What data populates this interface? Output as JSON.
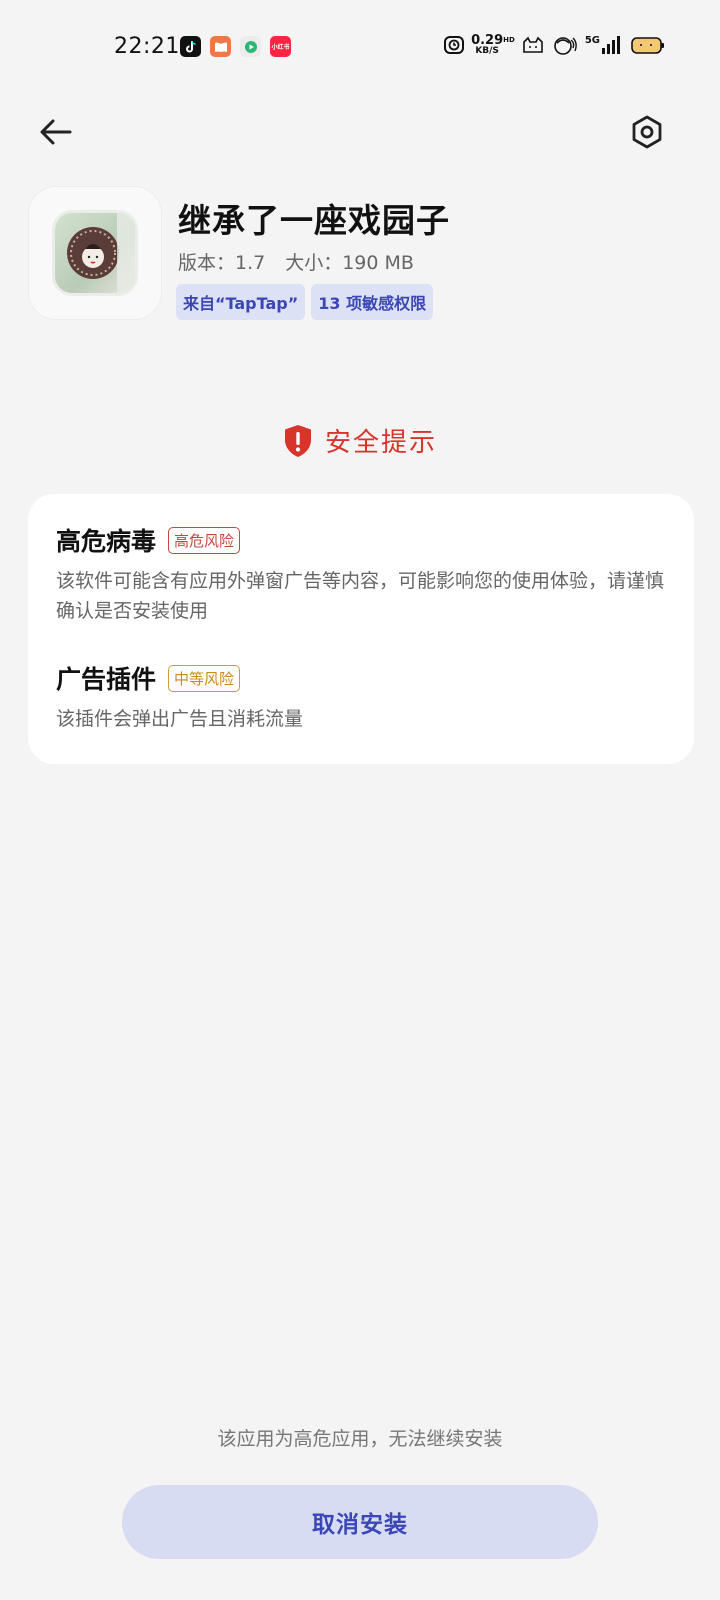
{
  "status_bar": {
    "time": "22:21",
    "net_speed_value": "0.29",
    "net_speed_unit": "KB/S",
    "network_type": "5G",
    "hd_label": "HD",
    "notification_apps": [
      "tiktok-icon",
      "books-icon",
      "video-icon",
      "xiaohongshu-icon"
    ],
    "xhs_label": "小红书"
  },
  "app": {
    "name": "继承了一座戏园子",
    "version_label": "版本：1.7",
    "size_label": "大小：190 MB",
    "source_tag": "来自“TapTap”",
    "permission_tag": "13 项敏感权限"
  },
  "warning": {
    "title": "安全提示",
    "items": [
      {
        "name": "高危病毒",
        "level": "高危风险",
        "desc": "该软件可能含有应用外弹窗广告等内容，可能影响您的使用体验，请谨慎确认是否安装使用"
      },
      {
        "name": "广告插件",
        "level": "中等风险",
        "desc": "该插件会弹出广告且消耗流量"
      }
    ]
  },
  "footer": {
    "note": "该应用为高危应用，无法继续安装",
    "cancel_label": "取消安装"
  },
  "colors": {
    "accent": "#3b47b5",
    "danger": "#d8342a",
    "warning": "#c98a1d",
    "background": "#f4f4f4"
  }
}
